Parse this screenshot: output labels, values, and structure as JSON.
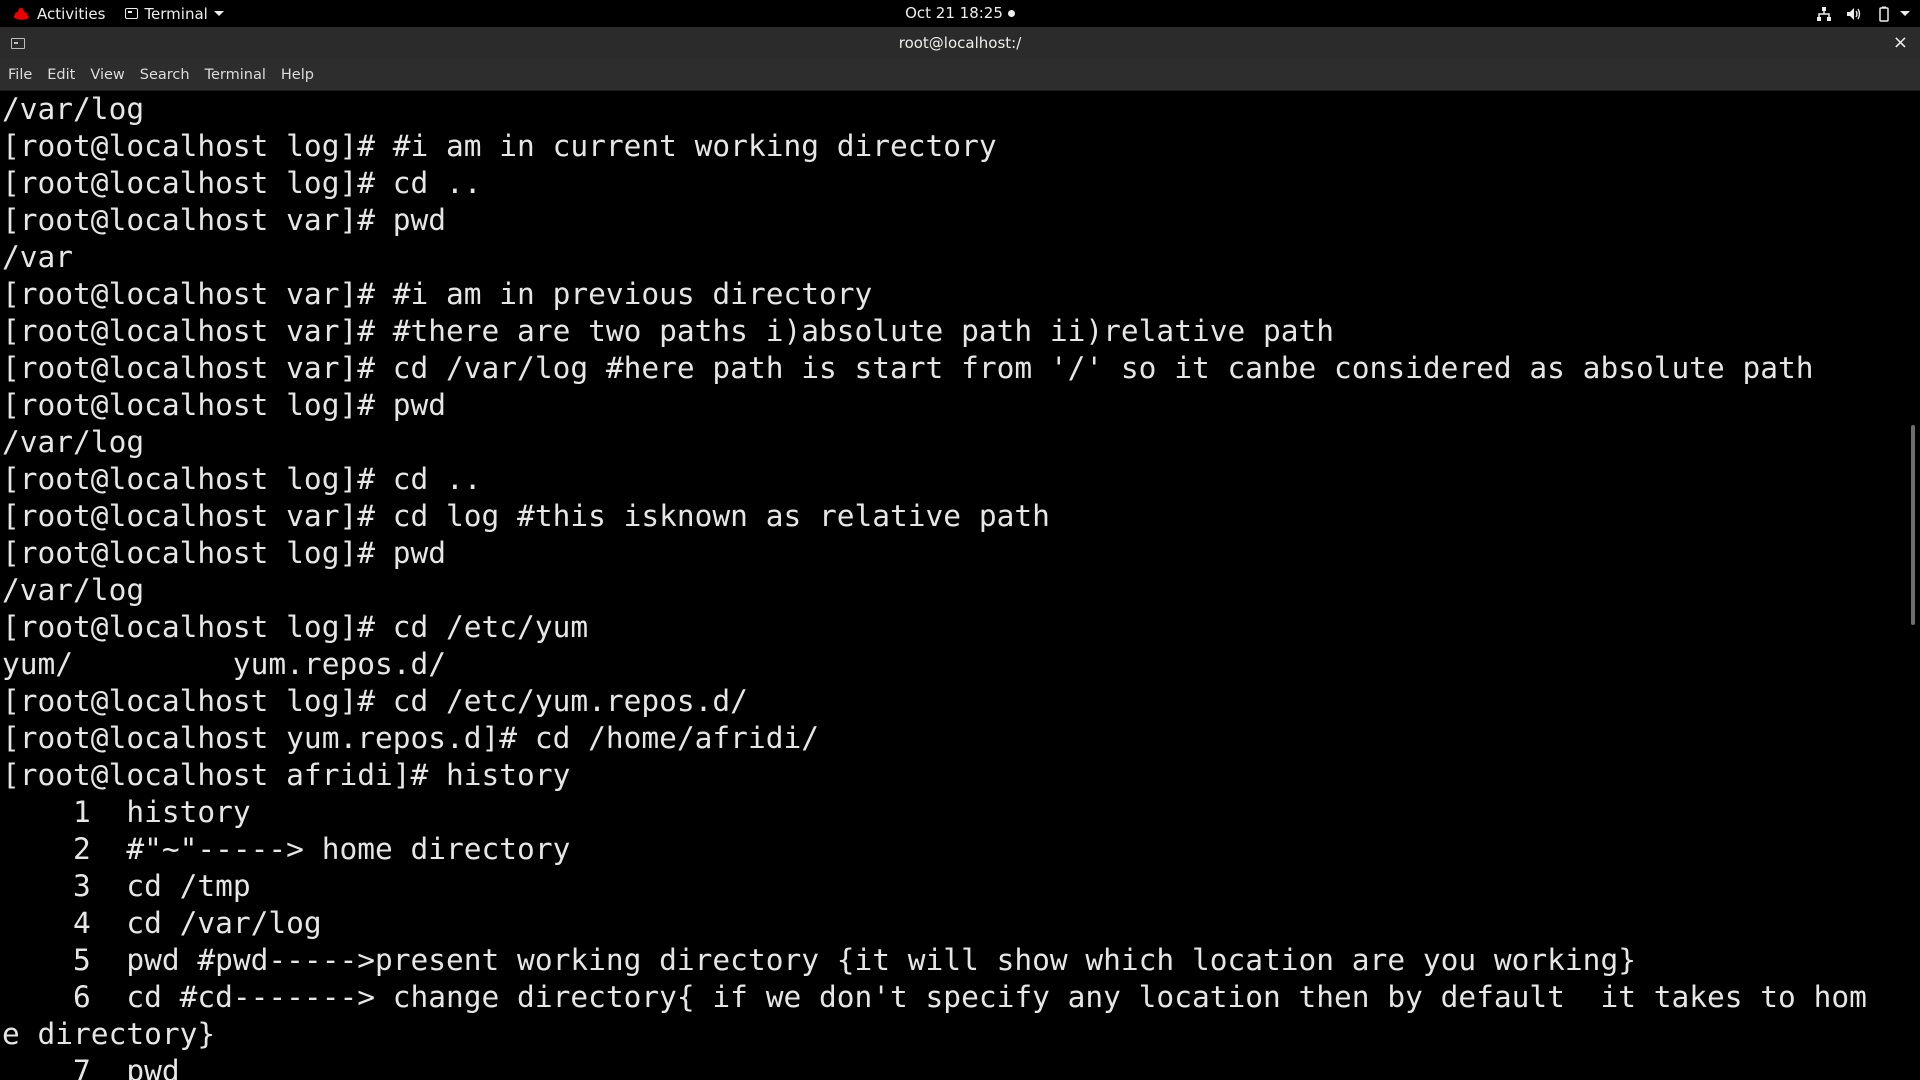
{
  "topbar": {
    "activities": "Activities",
    "app_menu": "Terminal",
    "clock": "Oct 21  18:25",
    "icons": [
      "network-icon",
      "volume-icon",
      "battery-icon",
      "system-menu-caret-icon"
    ]
  },
  "window": {
    "title": "root@localhost:/",
    "close": "×"
  },
  "menu": [
    "File",
    "Edit",
    "View",
    "Search",
    "Terminal",
    "Help"
  ],
  "terminal": {
    "lines": [
      "/var/log",
      "[root@localhost log]# #i am in current working directory",
      "[root@localhost log]# cd ..",
      "[root@localhost var]# pwd",
      "/var",
      "[root@localhost var]# #i am in previous directory",
      "[root@localhost var]# #there are two paths i)absolute path ii)relative path",
      "[root@localhost var]# cd /var/log #here path is start from '/' so it canbe considered as absolute path",
      "[root@localhost log]# pwd",
      "/var/log",
      "[root@localhost log]# cd ..",
      "[root@localhost var]# cd log #this isknown as relative path",
      "[root@localhost log]# pwd",
      "/var/log",
      "[root@localhost log]# cd /etc/yum",
      "yum/         yum.repos.d/",
      "[root@localhost log]# cd /etc/yum.repos.d/",
      "[root@localhost yum.repos.d]# cd /home/afridi/",
      "[root@localhost afridi]# history",
      "    1  history",
      "    2  #\"~\"-----> home directory",
      "    3  cd /tmp",
      "    4  cd /var/log",
      "    5  pwd #pwd----->present working directory {it will show which location are you working}",
      "    6  cd #cd-------> change directory{ if we don't specify any location then by default  it takes to hom",
      "e directory}",
      "    7  pwd"
    ]
  },
  "colors": {
    "topbar_bg": "#000000",
    "titlebar_bg": "#2b2b2b",
    "menubar_bg": "#2d2d2d",
    "terminal_bg": "#000000",
    "terminal_fg": "#e6e6e6",
    "redhat_red": "#ee0000"
  }
}
